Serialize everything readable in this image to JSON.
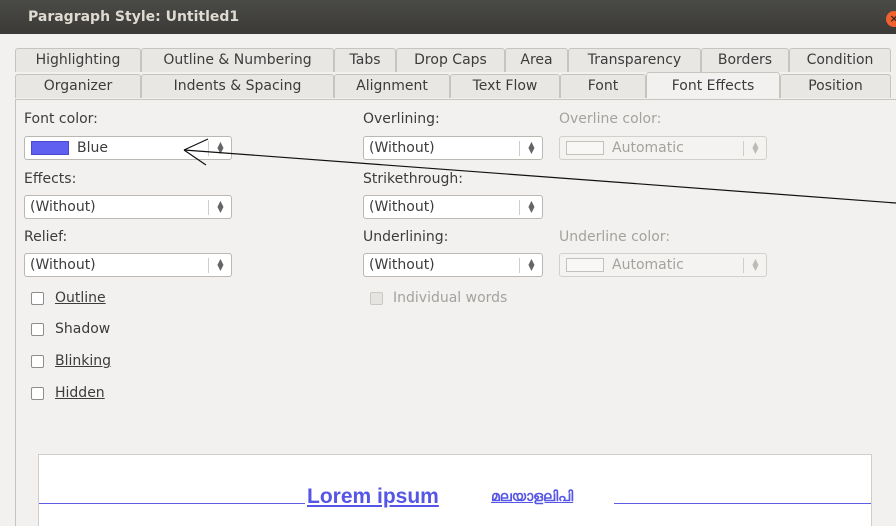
{
  "window": {
    "title": "Paragraph Style: Untitled1",
    "close_glyph": "×"
  },
  "tabs_row1": [
    "Highlighting",
    "Outline & Numbering",
    "Tabs",
    "Drop Caps",
    "Area",
    "Transparency",
    "Borders",
    "Condition"
  ],
  "tabs_row2": [
    "Organizer",
    "Indents & Spacing",
    "Alignment",
    "Text Flow",
    "Font",
    "Font Effects",
    "Position"
  ],
  "active_tab": "Font Effects",
  "font_color": {
    "label": "Font color:",
    "value": "Blue",
    "swatch": "#6060f0"
  },
  "effects": {
    "label": "Effects:",
    "value": "(Without)"
  },
  "relief": {
    "label": "Relief:",
    "value": "(Without)"
  },
  "overlining": {
    "label": "Overlining:",
    "value": "(Without)"
  },
  "overline_color": {
    "label": "Overline color:",
    "value": "Automatic"
  },
  "strikethrough": {
    "label": "Strikethrough:",
    "value": "(Without)"
  },
  "underlining": {
    "label": "Underlining:",
    "value": "(Without)"
  },
  "underline_color": {
    "label": "Underline color:",
    "value": "Automatic"
  },
  "checkboxes": {
    "outline": {
      "label": "Outline",
      "checked": false
    },
    "shadow": {
      "label": "Shadow",
      "checked": false
    },
    "blinking": {
      "label": "Blinking",
      "checked": false
    },
    "hidden": {
      "label": "Hidden",
      "checked": false
    },
    "individual_words": {
      "label": "Individual words",
      "checked": false
    }
  },
  "preview": {
    "latin_text": "Lorem ipsum",
    "malayalam_text": "മലയാളലിപി"
  },
  "colors": {
    "accent_blue": "#5555e6",
    "titlebar": "#3b3a36",
    "close": "#f1602f"
  }
}
